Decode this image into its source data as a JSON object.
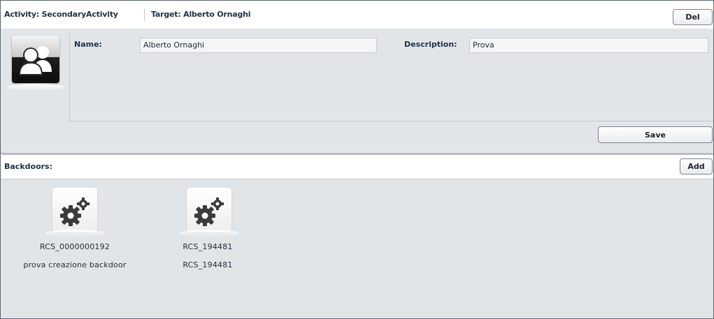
{
  "breadcrumb": {
    "activity": "Activity: SecondaryActivity",
    "target": "Target: Alberto Ornaghi"
  },
  "toolbar": {
    "del_label": "Del"
  },
  "details": {
    "avatar_icon": "user-group-icon",
    "name_label": "Name:",
    "name_value": "Alberto Ornaghi",
    "description_label": "Description:",
    "description_value": "Prova",
    "save_label": "Save"
  },
  "backdoors": {
    "title": "Backdoors:",
    "add_label": "Add",
    "items": [
      {
        "icon": "gears-icon",
        "name": "RCS_0000000192",
        "description": "prova creazione backdoor"
      },
      {
        "icon": "gears-icon",
        "name": "RCS_194481",
        "description": "RCS_194481"
      }
    ]
  }
}
